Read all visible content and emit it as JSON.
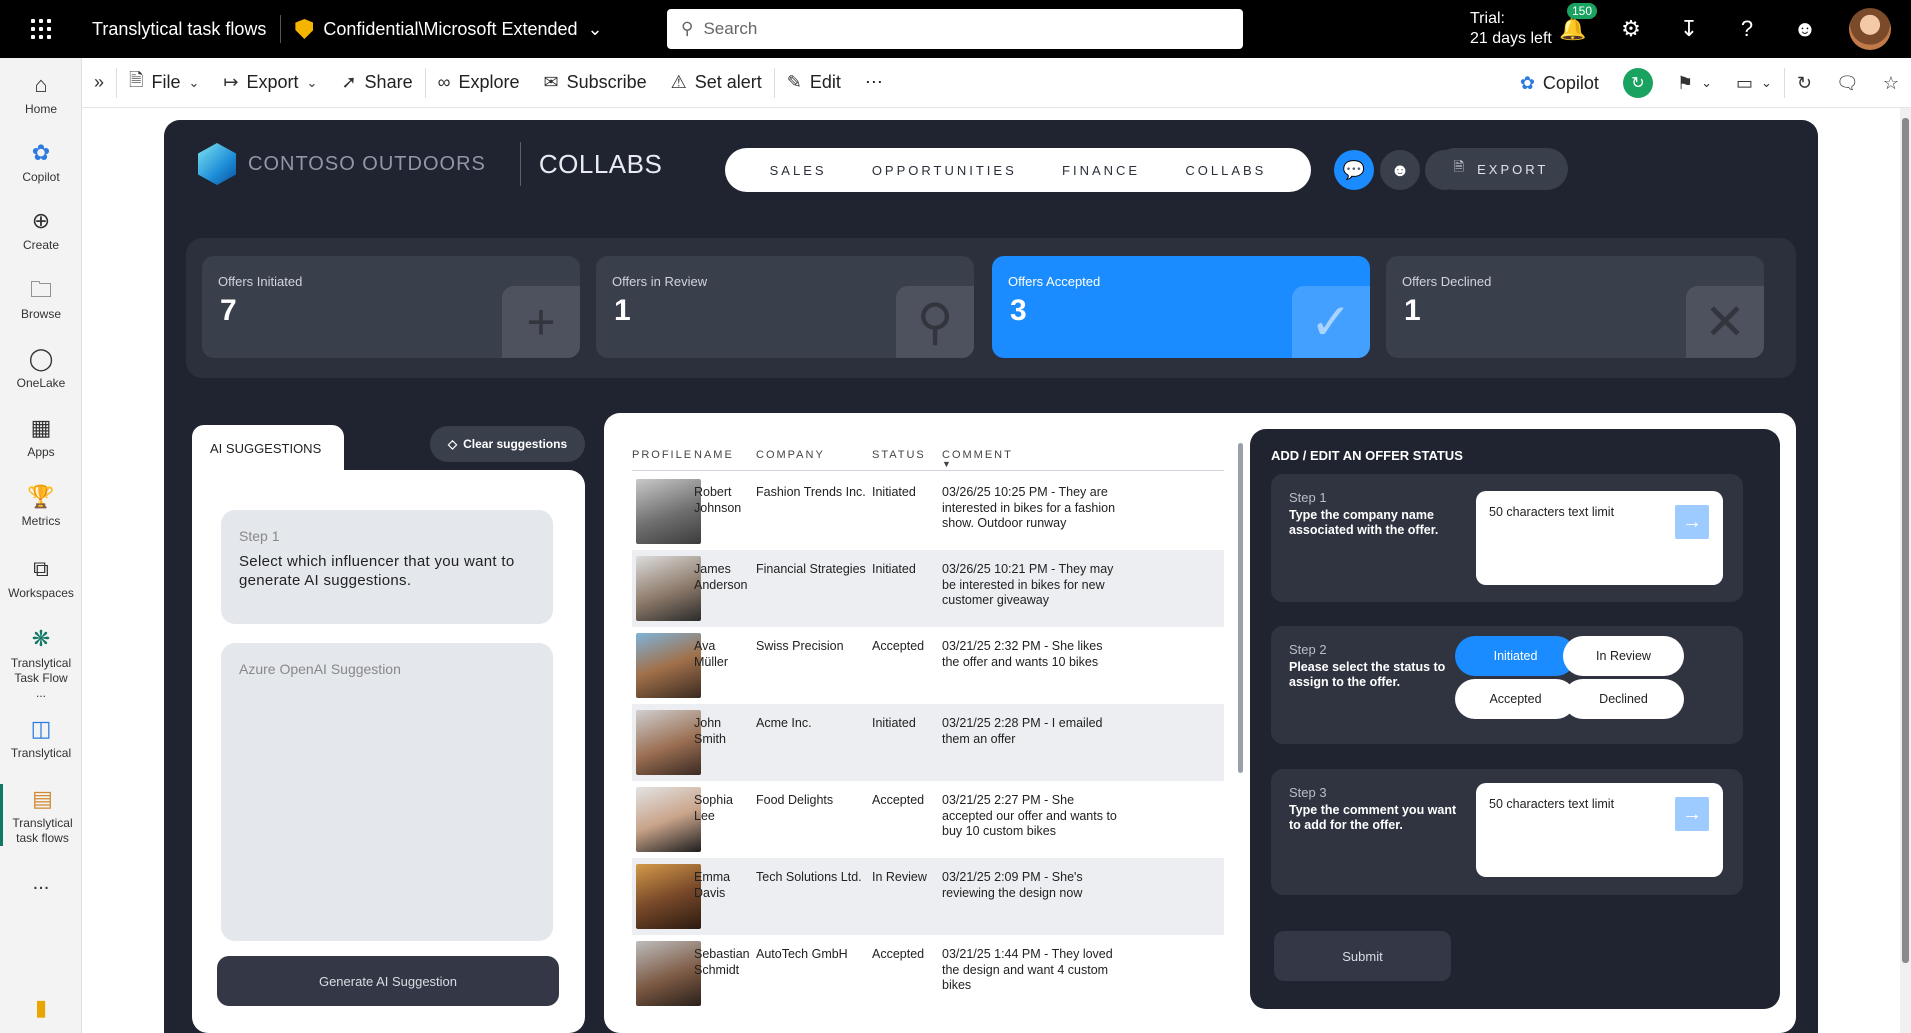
{
  "topbar": {
    "app_title": "Translytical task flows",
    "sensitivity": "Confidential\\Microsoft Extended",
    "search_placeholder": "Search",
    "trial_line1": "Trial:",
    "trial_line2": "21 days left",
    "notification_count": "150"
  },
  "rail": {
    "items": [
      {
        "label": "Home"
      },
      {
        "label": "Copilot"
      },
      {
        "label": "Create"
      },
      {
        "label": "Browse"
      },
      {
        "label": "OneLake"
      },
      {
        "label": "Apps"
      },
      {
        "label": "Metrics"
      },
      {
        "label": "Workspaces"
      },
      {
        "label": "Translytical Task Flow ..."
      },
      {
        "label": "Translytical"
      },
      {
        "label": "Translytical task flows"
      }
    ],
    "more": "..."
  },
  "cmdbar": {
    "file": "File",
    "export": "Export",
    "share": "Share",
    "explore": "Explore",
    "subscribe": "Subscribe",
    "set_alert": "Set alert",
    "edit": "Edit",
    "more": "⋯",
    "copilot": "Copilot"
  },
  "report": {
    "brand_name": "CONTOSO OUTDOORS",
    "page_title": "COLLABS",
    "nav": [
      "SALES",
      "OPPORTUNITIES",
      "FINANCE",
      "COLLABS"
    ],
    "export_label": "EXPORT",
    "kpis": [
      {
        "label": "Offers Initiated",
        "value": "7",
        "icon": "plus-icon"
      },
      {
        "label": "Offers in Review",
        "value": "1",
        "icon": "magnifier-icon"
      },
      {
        "label": "Offers Accepted",
        "value": "3",
        "icon": "check-icon"
      },
      {
        "label": "Offers Declined",
        "value": "1",
        "icon": "x-icon"
      }
    ],
    "ai": {
      "tab_label": "AI SUGGESTIONS",
      "clear_label": "Clear suggestions",
      "step1_label": "Step 1",
      "step1_text": "Select which influencer that you want to generate AI suggestions.",
      "azure_label": "Azure OpenAI Suggestion",
      "generate_label": "Generate AI Suggestion"
    },
    "table": {
      "headers": [
        "PROFILE",
        "NAME",
        "COMPANY",
        "STATUS",
        "COMMENT"
      ],
      "rows": [
        {
          "name": "Robert Johnson",
          "company": "Fashion Trends Inc.",
          "status": "Initiated",
          "comment": "03/26/25 10:25 PM - They are interested in bikes for a fashion show. Outdoor runway"
        },
        {
          "name": "James Anderson",
          "company": "Financial Strategies",
          "status": "Initiated",
          "comment": "03/26/25 10:21 PM - They may be interested in bikes for new customer giveaway"
        },
        {
          "name": "Ava Müller",
          "company": "Swiss Precision",
          "status": "Accepted",
          "comment": "03/21/25 2:32 PM - She likes the offer and wants 10 bikes"
        },
        {
          "name": "John Smith",
          "company": "Acme Inc.",
          "status": "Initiated",
          "comment": "03/21/25 2:28 PM - I emailed them an offer"
        },
        {
          "name": "Sophia Lee",
          "company": "Food Delights",
          "status": "Accepted",
          "comment": "03/21/25 2:27 PM - She accepted our offer and wants to buy 10 custom bikes"
        },
        {
          "name": "Emma Davis",
          "company": "Tech Solutions Ltd.",
          "status": "In Review",
          "comment": "03/21/25 2:09 PM - She's reviewing the design now"
        },
        {
          "name": "Sebastian Schmidt",
          "company": "AutoTech GmbH",
          "status": "Accepted",
          "comment": "03/21/25 1:44 PM - They loved the design and want 4 custom bikes"
        }
      ]
    },
    "edit": {
      "title": "ADD / EDIT AN OFFER STATUS",
      "step1_label": "Step 1",
      "step1_text": "Type the company name associated with the offer.",
      "step1_input": "50 characters text limit",
      "step2_label": "Step 2",
      "step2_text": "Please select the status to assign to the offer.",
      "statuses": [
        "Initiated",
        "In Review",
        "Accepted",
        "Declined"
      ],
      "selected_status": "Initiated",
      "step3_label": "Step 3",
      "step3_text": "Type the comment you want to add for the offer.",
      "step3_input": "50 characters text limit",
      "submit_label": "Submit"
    }
  },
  "colors": {
    "accent": "#1a8cff",
    "report_bg": "#1f2430",
    "card_bg": "#3a3f4c",
    "brand_green": "#117865"
  }
}
